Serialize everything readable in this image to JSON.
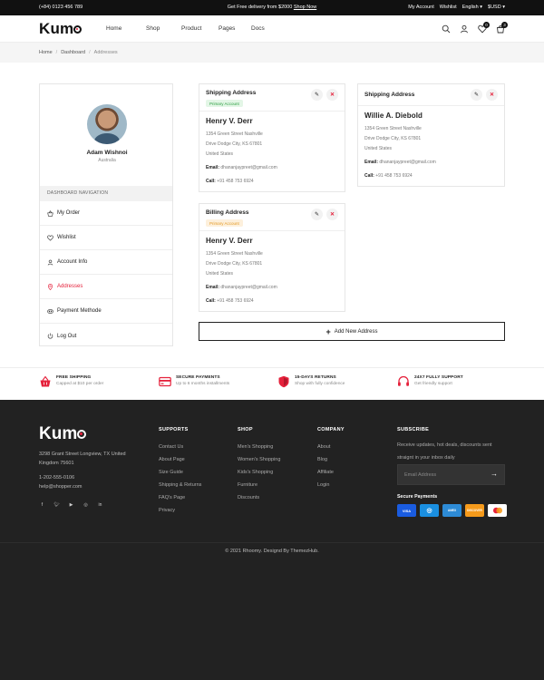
{
  "topbar": {
    "phone": "(+84) 0123 456 789",
    "promo_text": "Get Free delivery from $2000",
    "promo_link": "Shop Now",
    "account": "My Account",
    "wishlist": "Wishlist",
    "language": "English",
    "currency": "$USD"
  },
  "header": {
    "logo": "Kumo",
    "nav": [
      "Home",
      "Shop",
      "Product",
      "Pages",
      "Docs"
    ],
    "wishlist_count": "0",
    "cart_count": "3"
  },
  "breadcrumb": [
    "Home",
    "Dashboard",
    "Addresses"
  ],
  "sidebar": {
    "user_name": "Adam Wishnoi",
    "user_location": "Australia",
    "section_title": "DASHBOARD NAVIGATION",
    "items": [
      {
        "label": "My Order",
        "icon": "basket-icon"
      },
      {
        "label": "Wishlist",
        "icon": "heart-icon"
      },
      {
        "label": "Account Info",
        "icon": "user-icon"
      },
      {
        "label": "Addresses",
        "icon": "location-pin-icon",
        "active": true
      },
      {
        "label": "Payment Methode",
        "icon": "credit-card-icon"
      },
      {
        "label": "Log Out",
        "icon": "power-icon"
      }
    ]
  },
  "addresses": {
    "shipping_primary": {
      "title": "Shipping Address",
      "badge": "Primary Account",
      "name": "Henry V. Derr",
      "street": "1354 Green Street Nashville",
      "city": "Drive Dodge City, KS 67801",
      "country": "United States",
      "email_label": "Email:",
      "email": "dhananjaypreet@gmail.com",
      "call_label": "Call:",
      "phone": "+91 458 753 6924"
    },
    "billing": {
      "title": "Billing Address",
      "badge": "Primary Account",
      "name": "Henry V. Derr",
      "street": "1354 Green Street Nashville",
      "city": "Drive Dodge City, KS 67801",
      "country": "United States",
      "email_label": "Email:",
      "email": "dhananjaypreet@gmail.com",
      "call_label": "Call:",
      "phone": "+91 458 753 6924"
    },
    "shipping_secondary": {
      "title": "Shipping Address",
      "name": "Willie A. Diebold",
      "street": "1354 Green Street Nashville",
      "city": "Drive Dodge City, KS 67801",
      "country": "United States",
      "email_label": "Email:",
      "email": "dhananjaypreet@gmail.com",
      "call_label": "Call:",
      "phone": "+91 458 753 6924"
    },
    "add_button": "Add New Address"
  },
  "features": [
    {
      "title": "FREE SHIPPING",
      "sub": "Capped at $10 per order",
      "icon": "basket-icon"
    },
    {
      "title": "SECURE PAYMENTS",
      "sub": "Up to 6 months installments",
      "icon": "credit-card-icon"
    },
    {
      "title": "15-DAYS RETURNS",
      "sub": "Shop with fully confidence",
      "icon": "shield-icon"
    },
    {
      "title": "24X7 FULLY SUPPORT",
      "sub": "Get friendly support",
      "icon": "headset-icon"
    }
  ],
  "footer": {
    "logo": "Kumo",
    "address": "3298 Grant Street Longview, TX United Kingdom 75601",
    "phone": "1-202-555-0106",
    "email": "help@shopper.com",
    "columns": [
      {
        "title": "SUPPORTS",
        "links": [
          "Contact Us",
          "About Page",
          "Size Guide",
          "Shipping & Returns",
          "FAQ's Page",
          "Privacy"
        ]
      },
      {
        "title": "SHOP",
        "links": [
          "Men's Shopping",
          "Women's Shopping",
          "Kids's Shopping",
          "Furniture",
          "Discounts"
        ]
      },
      {
        "title": "COMPANY",
        "links": [
          "About",
          "Blog",
          "Affiliate",
          "Login"
        ]
      }
    ],
    "subscribe_title": "SUBSCRIBE",
    "subscribe_text": "Receive updates, hot deals, discounts sent straignt in your inbox daily",
    "email_placeholder": "Email Address",
    "secure_payments": "Secure Payments",
    "payment_methods": [
      "VISA",
      "Diners",
      "AMEX",
      "DISCOVER",
      "Mastercard"
    ],
    "copyright": "© 2021 Rhoomy. Designd By ThemezHub."
  }
}
